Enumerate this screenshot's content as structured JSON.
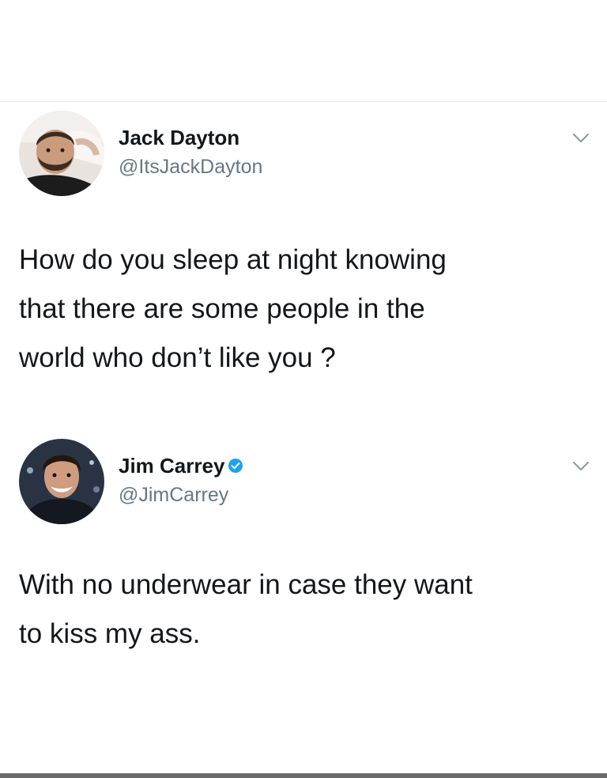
{
  "tweets": [
    {
      "display_name": "Jack Dayton",
      "handle": "@ItsJackDayton",
      "verified": false,
      "avatar_icon": "avatar-photo-icon",
      "menu_icon": "chevron-down-icon",
      "text": "How do you sleep at night knowing\nthat there are some people in the\nworld who don’t like you ?"
    },
    {
      "display_name": "Jim Carrey",
      "handle": "@JimCarrey",
      "verified": true,
      "avatar_icon": "avatar-photo-icon",
      "menu_icon": "chevron-down-icon",
      "text": "With no underwear in case they want\nto kiss my ass."
    }
  ],
  "colors": {
    "text": "#14171a",
    "handle": "#657786",
    "verified": "#1da1f2",
    "caret": "#8899a6",
    "divider": "#e6ecf0"
  }
}
